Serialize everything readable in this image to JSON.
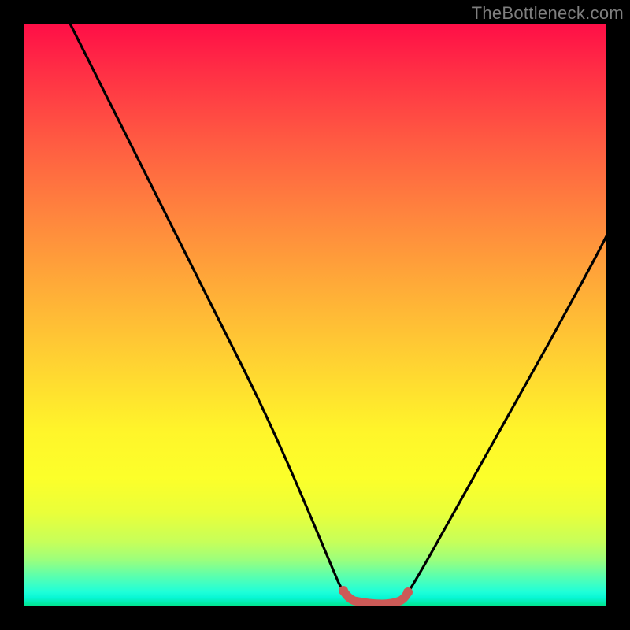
{
  "watermark": {
    "text": "TheBottleneck.com"
  },
  "colors": {
    "black": "#000000",
    "curve": "#000000",
    "marker": "#cc5a57",
    "gradient_top": "#ff0e47",
    "gradient_bottom": "#00e38a"
  },
  "chart_data": {
    "type": "line",
    "title": "",
    "xlabel": "",
    "ylabel": "",
    "xlim": [
      0,
      100
    ],
    "ylim": [
      0,
      100
    ],
    "grid": false,
    "legend": false,
    "series": [
      {
        "name": "left-curve",
        "x": [
          8,
          12,
          16,
          20,
          24,
          28,
          32,
          36,
          40,
          44,
          48,
          50,
          52,
          54,
          55
        ],
        "y": [
          100,
          94,
          88,
          81,
          74,
          67,
          59,
          51,
          42,
          33,
          22,
          16,
          10,
          5,
          2
        ]
      },
      {
        "name": "right-curve",
        "x": [
          65,
          66,
          68,
          70,
          73,
          76,
          80,
          84,
          88,
          92,
          96,
          100
        ],
        "y": [
          2,
          4,
          8,
          12,
          18,
          24,
          32,
          40,
          48,
          55,
          62,
          68
        ]
      },
      {
        "name": "valley-highlight",
        "x": [
          55,
          56,
          58,
          60,
          62,
          64,
          65
        ],
        "y": [
          2,
          1.2,
          0.8,
          0.7,
          0.8,
          1.2,
          2
        ]
      }
    ],
    "annotations": []
  }
}
